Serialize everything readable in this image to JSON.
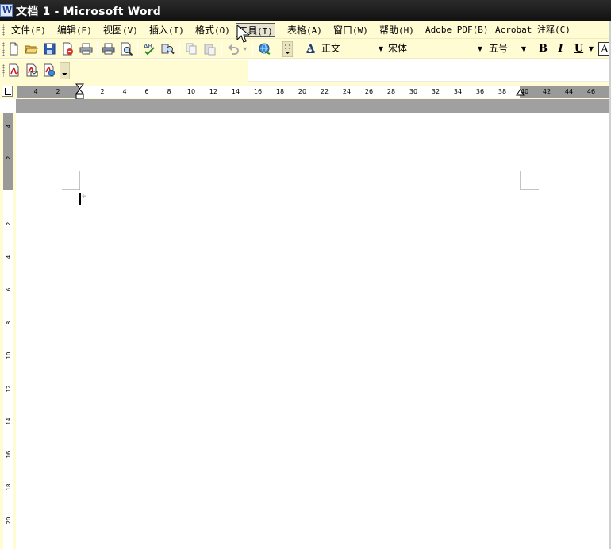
{
  "window": {
    "title": "文档 1 - Microsoft Word"
  },
  "menu": {
    "items": [
      {
        "label": "文件",
        "hotkey": "(F)"
      },
      {
        "label": "编辑",
        "hotkey": "(E)"
      },
      {
        "label": "视图",
        "hotkey": "(V)"
      },
      {
        "label": "插入",
        "hotkey": "(I)"
      },
      {
        "label": "格式",
        "hotkey": "(O)"
      },
      {
        "label": "工具",
        "hotkey": "(T)"
      },
      {
        "label": "表格",
        "hotkey": "(A)"
      },
      {
        "label": "窗口",
        "hotkey": "(W)"
      },
      {
        "label": "帮助",
        "hotkey": "(H)"
      },
      {
        "label": "Adobe PDF",
        "hotkey": "(B)"
      },
      {
        "label": "Acrobat 注释",
        "hotkey": "(C)"
      }
    ],
    "active_item": "工具"
  },
  "formatting": {
    "style": "正文",
    "font": "宋体",
    "size": "五号",
    "bold_label": "B",
    "italic_label": "I",
    "underline_label": "U",
    "char_label": "A",
    "style_icon_label": "A"
  },
  "icons": {
    "standard": [
      "new-document-icon",
      "open-folder-icon",
      "save-disk-icon",
      "permission-icon",
      "print-icon",
      "print-preview-icon",
      "spelling-grammar-icon",
      "research-icon",
      "copy-icon",
      "paste-icon",
      "undo-icon",
      "hyperlink-icon",
      "toolbar-options-icon",
      "styles-formatting-icon"
    ],
    "pdf": [
      "convert-to-pdf-icon",
      "convert-and-email-icon",
      "convert-and-send-for-review-icon"
    ]
  },
  "ruler": {
    "horizontal_ticks": [
      "4",
      "2",
      "2",
      "4",
      "6",
      "8",
      "10",
      "12",
      "14",
      "16",
      "18",
      "20",
      "22",
      "24",
      "26",
      "28",
      "30",
      "32",
      "34",
      "36",
      "38",
      "40",
      "42",
      "44",
      "46"
    ],
    "vertical_ticks": [
      "4",
      "2",
      "2",
      "4",
      "6",
      "8",
      "10",
      "12",
      "14",
      "16",
      "18",
      "20"
    ]
  },
  "colors": {
    "toolbar_bg": "#fffbd3",
    "titlebar_bg": "#1a1a1a",
    "ruler_margin": "#9a9a9a"
  }
}
